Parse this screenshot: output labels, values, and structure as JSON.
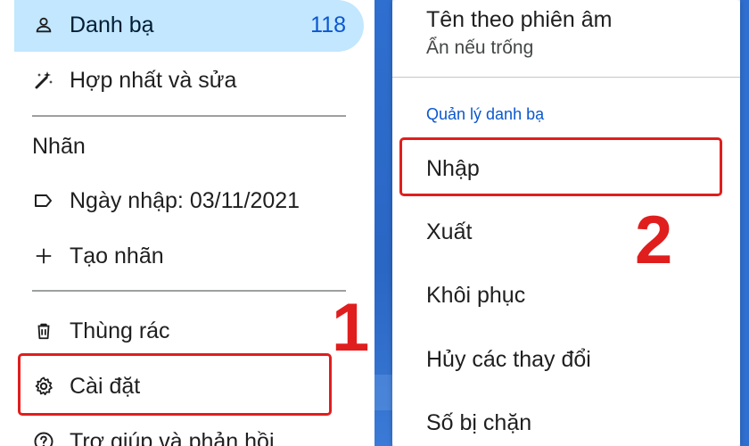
{
  "left_panel": {
    "contacts": {
      "label": "Danh bạ",
      "count": "118",
      "icon": "person-icon"
    },
    "merge_fix": {
      "label": "Hợp nhất và sửa",
      "icon": "magic-wand-icon"
    },
    "labels_heading": "Nhãn",
    "label_item": {
      "label": "Ngày nhập: 03/11/2021",
      "icon": "label-icon"
    },
    "create_label": {
      "label": "Tạo nhãn",
      "icon": "plus-icon"
    },
    "trash": {
      "label": "Thùng rác",
      "icon": "trash-icon"
    },
    "settings": {
      "label": "Cài đặt",
      "icon": "gear-icon"
    },
    "help": {
      "label": "Trợ giúp và phản hồi",
      "icon": "help-icon"
    }
  },
  "right_panel": {
    "phonetic_name": {
      "title": "Tên theo phiên âm",
      "value": "Ẩn nếu trống"
    },
    "manage_section": "Quản lý danh bạ",
    "items": [
      "Nhập",
      "Xuất",
      "Khôi phục",
      "Hủy các thay đổi",
      "Số bị chặn"
    ]
  },
  "annotations": {
    "step1": "1",
    "step2": "2"
  },
  "colors": {
    "active_bg": "#c2e7ff",
    "accent_blue": "#0b57d0",
    "annotation_red": "#e01e1e"
  }
}
